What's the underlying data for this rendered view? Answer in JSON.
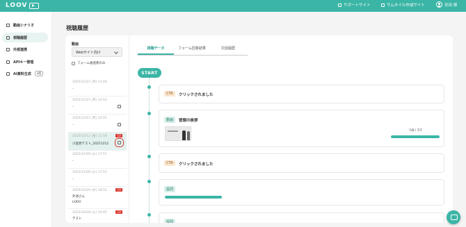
{
  "header": {
    "logo_text": "LOOV",
    "support_label": "サポートサイト",
    "thumbnail_label": "サムネイル作成サイト",
    "user_name": "安田 様",
    "accent": "#3bb5a6"
  },
  "sidebar": {
    "items": [
      {
        "label": "動画シナリオ",
        "icon": "video-icon"
      },
      {
        "label": "視聴履歴",
        "icon": "users-icon"
      },
      {
        "label": "外部連携",
        "icon": "link-icon"
      },
      {
        "label": "APIキー管理",
        "icon": "key-icon"
      },
      {
        "label": "AI資料生成",
        "icon": "document-icon",
        "badge": "α版"
      }
    ]
  },
  "page": {
    "title": "視聴履歴"
  },
  "left_panel": {
    "video_label": "動画",
    "select_value": "Webサイト向け",
    "checkbox_label": "フォーム通過者のみ",
    "sessions": [
      {
        "date": "2025/12/15 (月) 11:04",
        "name": "-",
        "badge": "",
        "icon": false
      },
      {
        "date": "2025/12/15 (月) 10:55",
        "name": "-",
        "badge": "",
        "icon": true
      },
      {
        "date": "2025/12/15 (月) 10:55",
        "name": "-",
        "badge": "",
        "icon": true
      },
      {
        "date": "2025/12/12 (金) 11:59",
        "name": "小笠原テスト_20251212",
        "badge": "CV",
        "icon": true,
        "selected": true
      },
      {
        "date": "2025/12/09 (火) 17:57",
        "name": "-",
        "badge": "",
        "icon": false
      },
      {
        "date": "2025/12/09 (火) 17:51",
        "name": "-",
        "badge": "",
        "icon": false
      },
      {
        "date": "2025/10/29 (水) 18:52",
        "name": "外池さん",
        "name2": "LOOV",
        "badge": "CV",
        "icon": false
      },
      {
        "date": "2025/10/28 (火) 19:05",
        "name": "テスト",
        "badge": "CV",
        "icon": false
      }
    ]
  },
  "tabs": [
    {
      "label": "視聴データ",
      "active": true
    },
    {
      "label": "フォーム回答結果",
      "active": false
    },
    {
      "label": "対話履歴",
      "active": false
    }
  ],
  "timeline": {
    "start_label": "START",
    "events": [
      {
        "tag": "CTA",
        "text": "クリックされました"
      },
      {
        "tag": "動画",
        "text": "冒頭の挨拶",
        "progress_label": "7/8 / 7/7",
        "progress": 1.0
      },
      {
        "tag": "CTA",
        "text": "クリックされました"
      },
      {
        "tag": "設問",
        "text": "",
        "progress": 1.0
      },
      {
        "tag": "設問",
        "text": ""
      }
    ]
  }
}
